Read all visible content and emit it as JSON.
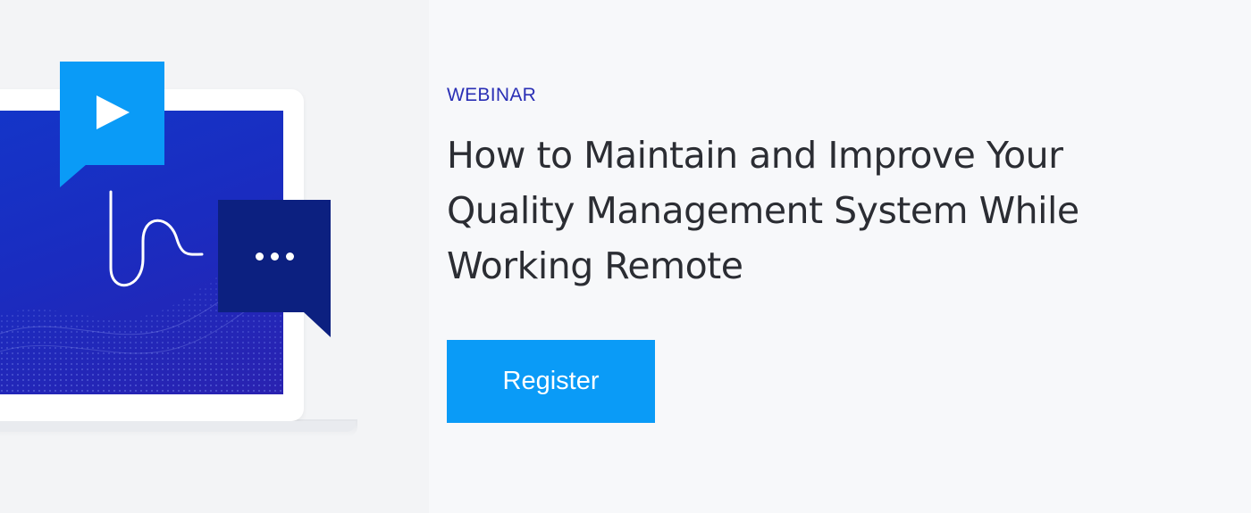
{
  "eyebrow": "WEBINAR",
  "title": "How to Maintain and Improve Your Quality Management System While Working Remote",
  "cta": {
    "label": "Register"
  },
  "icons": {
    "play": "play-icon",
    "chat": "chat-bubble-icon",
    "squiggle": "squiggle-line-icon",
    "laptop": "laptop-illustration"
  },
  "colors": {
    "accent": "#0a9bf7",
    "navy": "#0c2080",
    "eyebrow": "#2a2fb5",
    "title": "#2b2d33",
    "screen": "#1a2cc0"
  }
}
